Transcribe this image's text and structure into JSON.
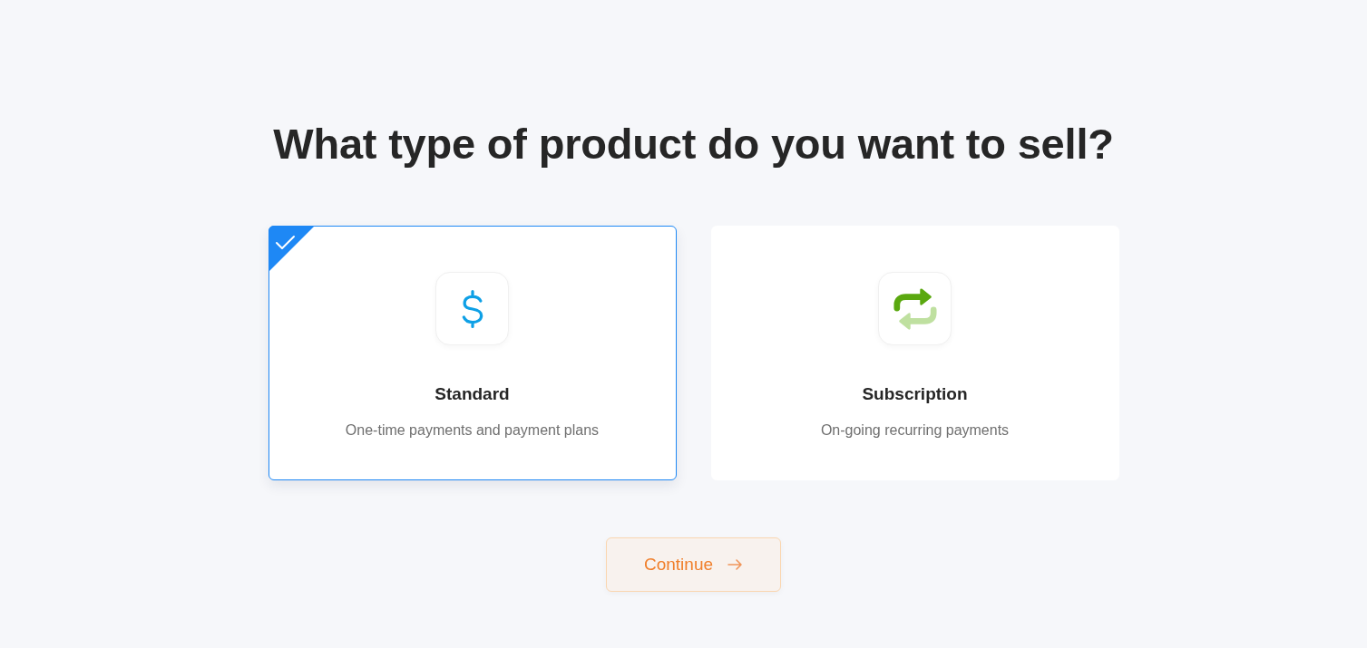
{
  "heading": "What type of product do you want to sell?",
  "options": [
    {
      "kind": "standard",
      "title": "Standard",
      "description": "One-time payments and payment plans",
      "selected": true
    },
    {
      "kind": "subscription",
      "title": "Subscription",
      "description": "On-going recurring payments",
      "selected": false
    }
  ],
  "continue_button": {
    "label": "Continue"
  }
}
